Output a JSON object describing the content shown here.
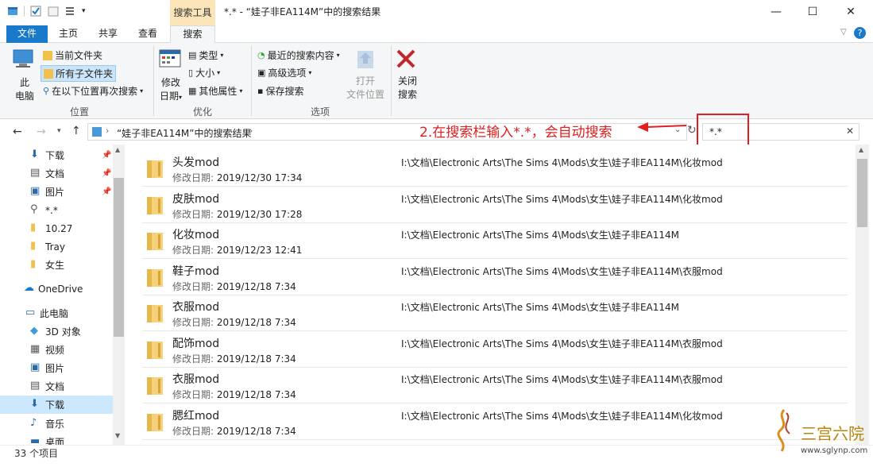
{
  "window": {
    "title": "*.* - “娃子非EA114M”中的搜索结果",
    "context_tab_label": "搜索工具"
  },
  "ribbon_tabs": [
    {
      "label": "文件"
    },
    {
      "label": "主页"
    },
    {
      "label": "共享"
    },
    {
      "label": "查看"
    },
    {
      "label": "搜索"
    }
  ],
  "ribbon": {
    "location": {
      "this_pc_line1": "此",
      "this_pc_line2": "电脑",
      "current_folder": "当前文件夹",
      "all_subfolders": "所有子文件夹",
      "search_again": "在以下位置再次搜索",
      "group": "位置"
    },
    "refine": {
      "date_line1": "修改",
      "date_line2": "日期",
      "kind": "类型",
      "size": "大小",
      "other_props": "其他属性",
      "group": "优化"
    },
    "options": {
      "recent_searches": "最近的搜索内容",
      "advanced": "高级选项",
      "save_search": "保存搜索",
      "open_location_line1": "打开",
      "open_location_line2": "文件位置",
      "close_line1": "关闭",
      "close_line2": "搜索",
      "group": "选项"
    }
  },
  "address": {
    "path": "“娃子非EA114M”中的搜索结果",
    "search_value": "*.*"
  },
  "annotation": {
    "text": "2.在搜索栏输入*.*，会自动搜索"
  },
  "nav": [
    {
      "label": "下载",
      "icon": "download-icon",
      "pinned": true
    },
    {
      "label": "文档",
      "icon": "document-icon",
      "pinned": true
    },
    {
      "label": "图片",
      "icon": "picture-icon",
      "pinned": true
    },
    {
      "label": "*.*",
      "icon": "search-icon",
      "pinned": false
    },
    {
      "label": "10.27",
      "icon": "folder-icon",
      "pinned": false
    },
    {
      "label": "Tray",
      "icon": "folder-icon",
      "pinned": false
    },
    {
      "label": "女生",
      "icon": "folder-icon",
      "pinned": false
    },
    {
      "label": "OneDrive",
      "icon": "cloud-icon",
      "pinned": false
    },
    {
      "label": "此电脑",
      "icon": "computer-icon",
      "pinned": false
    },
    {
      "label": "3D 对象",
      "icon": "cube-icon",
      "pinned": false
    },
    {
      "label": "视频",
      "icon": "video-icon",
      "pinned": false
    },
    {
      "label": "图片",
      "icon": "picture-icon",
      "pinned": false
    },
    {
      "label": "文档",
      "icon": "document-icon",
      "pinned": false
    },
    {
      "label": "下载",
      "icon": "download-icon",
      "pinned": false
    },
    {
      "label": "音乐",
      "icon": "music-icon",
      "pinned": false
    },
    {
      "label": "桌面",
      "icon": "desktop-icon",
      "pinned": false
    }
  ],
  "date_label": "修改日期:",
  "results": [
    {
      "name": "头发mod",
      "date": "2019/12/30 17:34",
      "path": "I:\\文档\\Electronic Arts\\The Sims 4\\Mods\\女生\\娃子非EA114M\\化妆mod"
    },
    {
      "name": "皮肤mod",
      "date": "2019/12/30 17:28",
      "path": "I:\\文档\\Electronic Arts\\The Sims 4\\Mods\\女生\\娃子非EA114M\\化妆mod"
    },
    {
      "name": "化妆mod",
      "date": "2019/12/23 12:41",
      "path": "I:\\文档\\Electronic Arts\\The Sims 4\\Mods\\女生\\娃子非EA114M"
    },
    {
      "name": "鞋子mod",
      "date": "2019/12/18 7:34",
      "path": "I:\\文档\\Electronic Arts\\The Sims 4\\Mods\\女生\\娃子非EA114M\\衣服mod"
    },
    {
      "name": "衣服mod",
      "date": "2019/12/18 7:34",
      "path": "I:\\文档\\Electronic Arts\\The Sims 4\\Mods\\女生\\娃子非EA114M"
    },
    {
      "name": "配饰mod",
      "date": "2019/12/18 7:34",
      "path": "I:\\文档\\Electronic Arts\\The Sims 4\\Mods\\女生\\娃子非EA114M\\衣服mod"
    },
    {
      "name": "衣服mod",
      "date": "2019/12/18 7:34",
      "path": "I:\\文档\\Electronic Arts\\The Sims 4\\Mods\\女生\\娃子非EA114M\\衣服mod"
    },
    {
      "name": "腮红mod",
      "date": "2019/12/18 7:34",
      "path": "I:\\文档\\Electronic Arts\\The Sims 4\\Mods\\女生\\娃子非EA114M\\化妆mod"
    }
  ],
  "status": {
    "count": "33 个项目"
  },
  "watermark": {
    "site_name": "三宫六院",
    "url": "www.sglynp.com"
  }
}
